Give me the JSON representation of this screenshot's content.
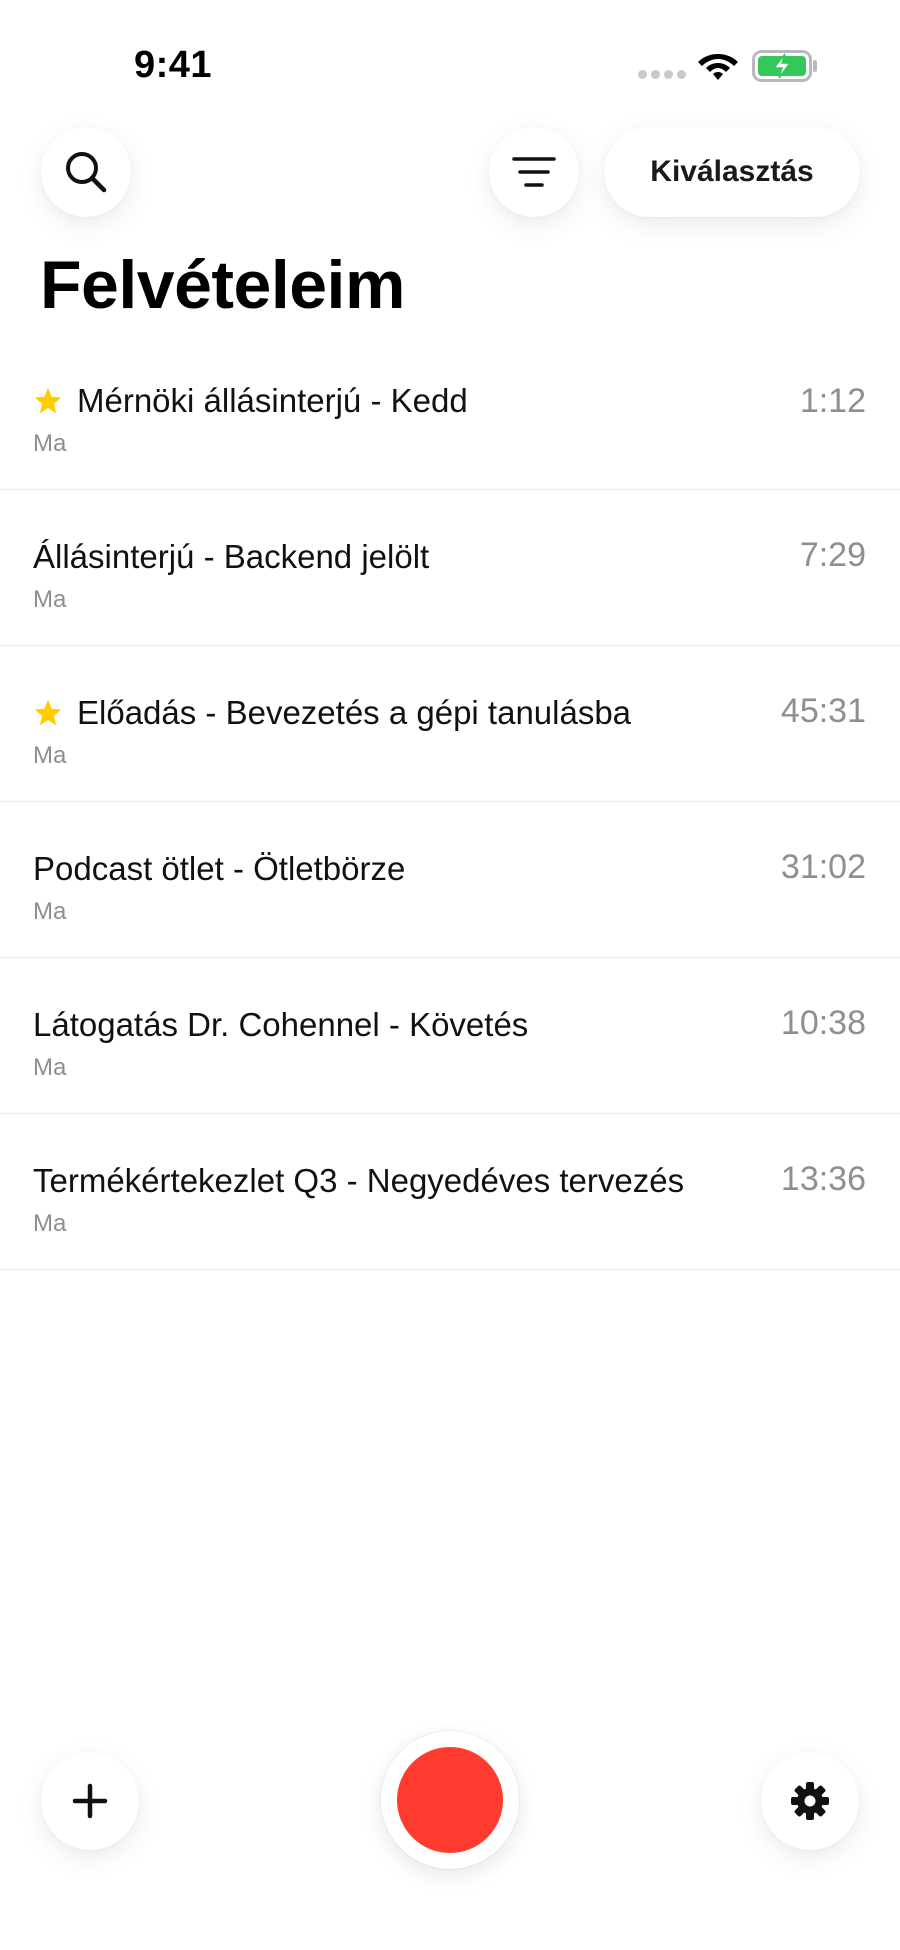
{
  "status_bar": {
    "time": "9:41",
    "icons": [
      "signal-dots-icon",
      "wifi-icon",
      "battery-charging-icon"
    ],
    "battery_color": "#34c759"
  },
  "toolbar": {
    "search_icon": "search-icon",
    "filter_icon": "filter-lines-icon",
    "select_label": "Kiválasztás"
  },
  "page": {
    "title": "Felvételeim"
  },
  "recordings": [
    {
      "title": "Mérnöki állásinterjú - Kedd",
      "date": "Ma",
      "duration": "1:12",
      "starred": true
    },
    {
      "title": "Állásinterjú - Backend jelölt",
      "date": "Ma",
      "duration": "7:29",
      "starred": false
    },
    {
      "title": "Előadás - Bevezetés a gépi tanulásba",
      "date": "Ma",
      "duration": "45:31",
      "starred": true
    },
    {
      "title": "Podcast ötlet - Ötletbörze",
      "date": "Ma",
      "duration": "31:02",
      "starred": false
    },
    {
      "title": "Látogatás Dr. Cohennel - Követés",
      "date": "Ma",
      "duration": "10:38",
      "starred": false
    },
    {
      "title": "Termékértekezlet Q3 - Negyedéves tervezés",
      "date": "Ma",
      "duration": "13:36",
      "starred": false
    }
  ],
  "bottom_bar": {
    "add_icon": "plus-icon",
    "record_icon": "record-icon",
    "settings_icon": "gear-icon",
    "record_color": "#ff3b30",
    "star_color": "#ffcc00"
  }
}
